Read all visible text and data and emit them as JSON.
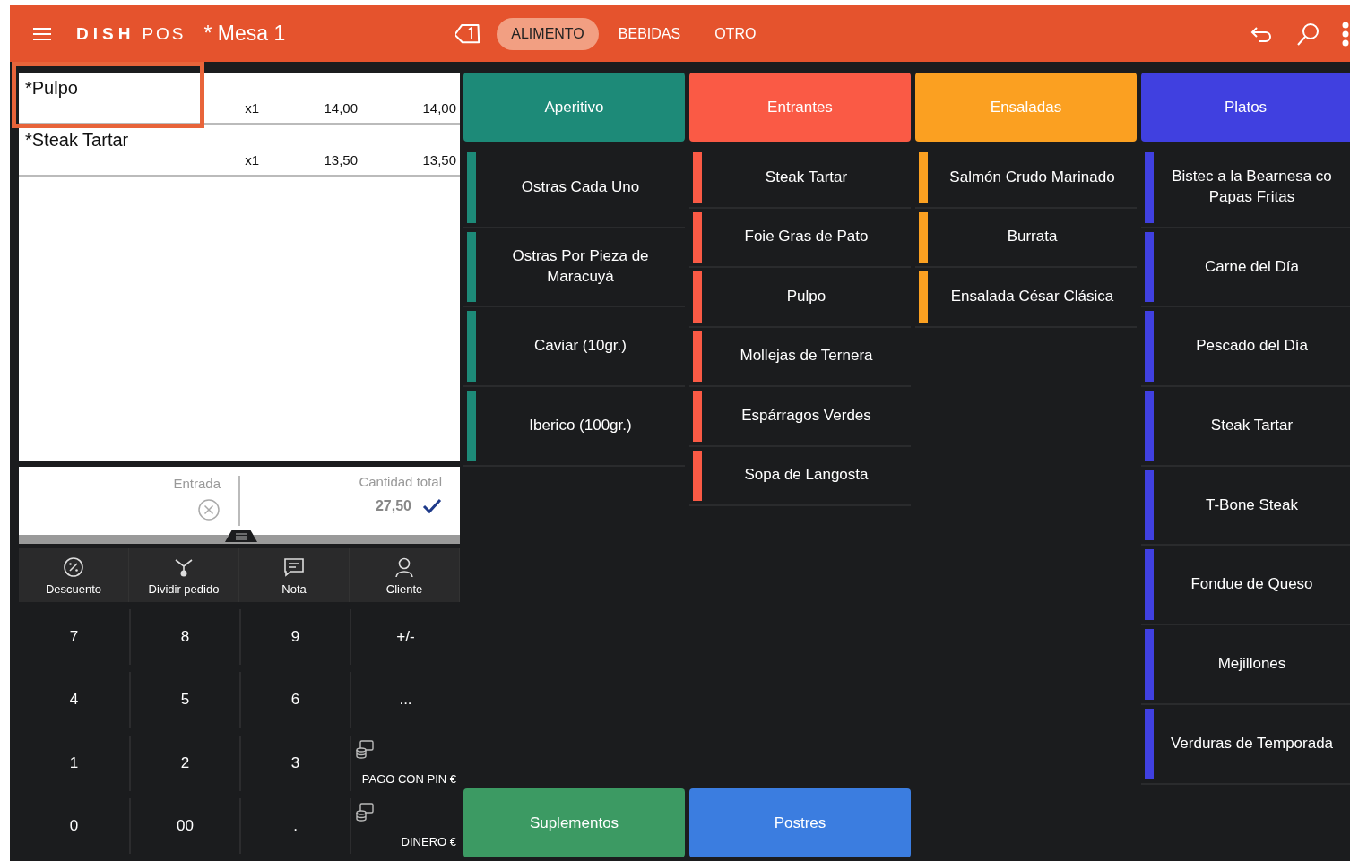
{
  "header": {
    "brand_bold": "DISH",
    "brand": "POS",
    "title": "* Mesa 1",
    "tabs": [
      {
        "label": "ALIMENTO",
        "selected": true
      },
      {
        "label": "BEBIDAS",
        "selected": false
      },
      {
        "label": "OTRO",
        "selected": false
      }
    ]
  },
  "order": {
    "lines": [
      {
        "name": "*Pulpo",
        "qty": "x1",
        "price": "14,00",
        "total": "14,00",
        "highlighted": true
      },
      {
        "name": "*Steak Tartar",
        "qty": "x1",
        "price": "13,50",
        "total": "13,50",
        "highlighted": false
      }
    ]
  },
  "summary": {
    "input_label": "Entrada",
    "total_label": "Cantidad total",
    "total": "27,50"
  },
  "actions": [
    {
      "label": "Descuento"
    },
    {
      "label": "Dividir pedido"
    },
    {
      "label": "Nota"
    },
    {
      "label": "Cliente"
    }
  ],
  "keypad": [
    {
      "kind": "key",
      "label": "7"
    },
    {
      "kind": "key",
      "label": "8"
    },
    {
      "kind": "key",
      "label": "9"
    },
    {
      "kind": "key",
      "label": "+/-"
    },
    {
      "kind": "key",
      "label": "4"
    },
    {
      "kind": "key",
      "label": "5"
    },
    {
      "kind": "key",
      "label": "6"
    },
    {
      "kind": "key",
      "label": "..."
    },
    {
      "kind": "key",
      "label": "1"
    },
    {
      "kind": "key",
      "label": "2"
    },
    {
      "kind": "key",
      "label": "3"
    },
    {
      "kind": "payment",
      "label": "PAGO CON PIN €"
    },
    {
      "kind": "key",
      "label": "0"
    },
    {
      "kind": "key",
      "label": "00"
    },
    {
      "kind": "key",
      "label": "."
    },
    {
      "kind": "payment",
      "label": "DINERO €"
    }
  ],
  "categories": [
    {
      "name": "Aperitivo",
      "color": "#1d8a78",
      "items": [
        "Ostras Cada Uno",
        "Ostras Por Pieza de Maracuyá",
        "Caviar (10gr.)",
        "Iberico (100gr.)"
      ]
    },
    {
      "name": "Entrantes",
      "color": "#fa5a45",
      "items": [
        "Steak Tartar",
        "Foie Gras de Pato",
        "Pulpo",
        "Mollejas de Ternera",
        "Espárragos Verdes",
        "Sopa de Langosta"
      ]
    },
    {
      "name": "Ensaladas",
      "color": "#fba021",
      "items": [
        "Salmón Crudo Marinado",
        "Burrata",
        "Ensalada César Clásica"
      ]
    },
    {
      "name": "Platos",
      "color": "#4040e0",
      "items": [
        "Bistec a la Bearnesa co Papas Fritas",
        "Carne del Día",
        "Pescado del Día",
        "Steak Tartar",
        "T-Bone Steak",
        "Fondue de Queso",
        "Mejillones",
        "Verduras de Temporada"
      ]
    }
  ],
  "bottom_categories": [
    {
      "name": "Suplementos",
      "color": "#3c9a63"
    },
    {
      "name": "Postres",
      "color": "#3b7de0"
    }
  ]
}
